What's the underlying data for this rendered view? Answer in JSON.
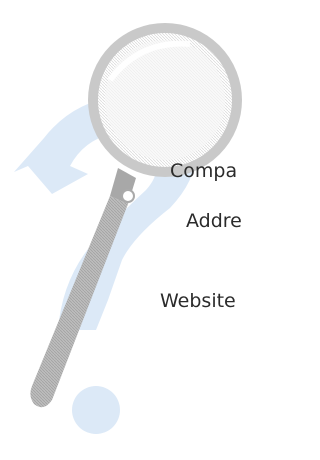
{
  "background": {
    "icon": "help-search-icon",
    "question_mark_color": "#d6e6f7",
    "lens_color": "#f0f0f0",
    "handle_color": "#bdbdbd"
  },
  "fields": {
    "company_label": "Compa",
    "address_label": "Addre",
    "website_label": "Website"
  }
}
